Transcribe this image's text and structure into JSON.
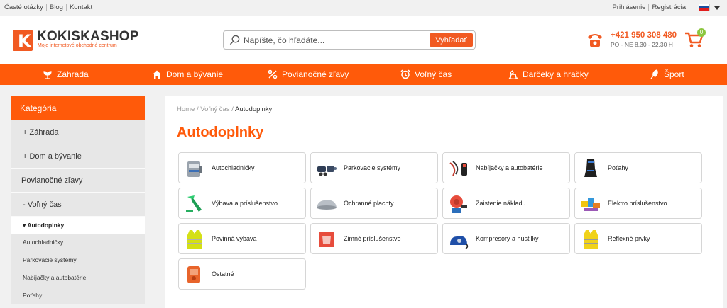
{
  "topbar": {
    "links": [
      "Časté otázky",
      "Blog",
      "Kontakt"
    ],
    "account": [
      "Prihlásenie",
      "Registrácia"
    ]
  },
  "header": {
    "logo_name": "KOKISKASHOP",
    "logo_tagline": "Moje internetové obchodné centrum",
    "search_placeholder": "Napíšte, čo hľadáte...",
    "search_button": "Vyhľadať",
    "phone": "+421 950 308 480",
    "hours": "PO - NE 8.30 - 22.30 H",
    "cart_count": "0"
  },
  "nav": [
    {
      "label": "Záhrada",
      "icon": "plant-icon"
    },
    {
      "label": "Dom a bývanie",
      "icon": "home-icon"
    },
    {
      "label": "Povianočné zľavy",
      "icon": "percent-icon"
    },
    {
      "label": "Voľný čas",
      "icon": "alarm-clock-icon"
    },
    {
      "label": "Darčeky a hračky",
      "icon": "rocking-horse-icon"
    },
    {
      "label": "Šport",
      "icon": "sport-icon"
    }
  ],
  "sidebar": {
    "title": "Kategória",
    "items": [
      "+ Záhrada",
      "+ Dom a bývanie",
      "Povianočné zľavy",
      "- Voľný čas"
    ],
    "active": "▾ Autodoplnky",
    "children": [
      "Autochladničky",
      "Parkovacie systémy",
      "Nabíjačky a autobatérie",
      "Poťahy"
    ]
  },
  "main": {
    "breadcrumb": [
      "Home",
      "Voľný čas",
      "Autodoplnky"
    ],
    "title": "Autodoplnky",
    "categories": [
      "Autochladničky",
      "Parkovacie systémy",
      "Nabíjačky a autobatérie",
      "Poťahy",
      "Výbava a príslušenstvo",
      "Ochranné plachty",
      "Zaistenie nákladu",
      "Elektro príslušenstvo",
      "Povinná výbava",
      "Zimné príslušenstvo",
      "Kompresory a hustilky",
      "Reflexné prvky",
      "Ostatné"
    ]
  },
  "colors": {
    "accent": "#ff5a0a",
    "brand": "#f15a22",
    "badge": "#8cc63f",
    "sidebar_bg": "#e7e7e7"
  }
}
